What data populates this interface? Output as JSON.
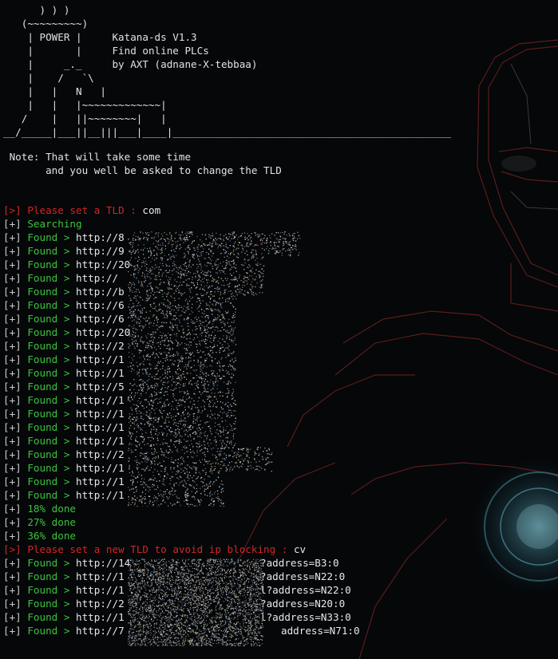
{
  "banner": {
    "art": "      ) ) )\n   (~~~~~~~~~)\n    | POWER |     Katana-ds V1.3\n    |       |     Find online PLCs\n    |     _._     by AXT (adnane-X-tebbaa)\n    |    /   `\\\n    |   |   N   |\n    |   |   |~~~~~~~~~~~~~|\n   /    |   ||~~~~~~~~|   |\n__/_____|___||__|||___|____|______________________________________________"
  },
  "note": {
    "line1": " Note: That will take some time",
    "line2": "       and you well be asked to change the TLD"
  },
  "log": [
    {
      "tag": "[>]",
      "label": "Please set a TLD : ",
      "value": "com",
      "kind": "prompt"
    },
    {
      "tag": "[+]",
      "label": "Searching",
      "value": "",
      "kind": "status"
    },
    {
      "tag": "[+]",
      "label": "Found > ",
      "value": "http://8",
      "kind": "found"
    },
    {
      "tag": "[+]",
      "label": "Found > ",
      "value": "http://9",
      "kind": "found"
    },
    {
      "tag": "[+]",
      "label": "Found > ",
      "value": "http://20",
      "kind": "found"
    },
    {
      "tag": "[+]",
      "label": "Found > ",
      "value": "http://",
      "kind": "found"
    },
    {
      "tag": "[+]",
      "label": "Found > ",
      "value": "http://b",
      "kind": "found"
    },
    {
      "tag": "[+]",
      "label": "Found > ",
      "value": "http://6",
      "kind": "found"
    },
    {
      "tag": "[+]",
      "label": "Found > ",
      "value": "http://6",
      "kind": "found"
    },
    {
      "tag": "[+]",
      "label": "Found > ",
      "value": "http://20",
      "kind": "found"
    },
    {
      "tag": "[+]",
      "label": "Found > ",
      "value": "http://2",
      "kind": "found"
    },
    {
      "tag": "[+]",
      "label": "Found > ",
      "value": "http://1",
      "kind": "found"
    },
    {
      "tag": "[+]",
      "label": "Found > ",
      "value": "http://1",
      "kind": "found"
    },
    {
      "tag": "[+]",
      "label": "Found > ",
      "value": "http://5",
      "kind": "found"
    },
    {
      "tag": "[+]",
      "label": "Found > ",
      "value": "http://1",
      "kind": "found"
    },
    {
      "tag": "[+]",
      "label": "Found > ",
      "value": "http://1",
      "kind": "found"
    },
    {
      "tag": "[+]",
      "label": "Found > ",
      "value": "http://1",
      "kind": "found"
    },
    {
      "tag": "[+]",
      "label": "Found > ",
      "value": "http://1",
      "kind": "found"
    },
    {
      "tag": "[+]",
      "label": "Found > ",
      "value": "http://2",
      "kind": "found"
    },
    {
      "tag": "[+]",
      "label": "Found > ",
      "value": "http://1",
      "kind": "found"
    },
    {
      "tag": "[+]",
      "label": "Found > ",
      "value": "http://1",
      "kind": "found"
    },
    {
      "tag": "[+]",
      "label": "Found > ",
      "value": "http://1",
      "kind": "found"
    },
    {
      "tag": "[+]",
      "label": "18% done",
      "value": "",
      "kind": "status"
    },
    {
      "tag": "[+]",
      "label": "27% done",
      "value": "",
      "kind": "status"
    },
    {
      "tag": "[+]",
      "label": "36% done",
      "value": "",
      "kind": "status"
    },
    {
      "tag": "[>]",
      "label": "Please set a new TLD to avoid ip blocking : ",
      "value": "cv",
      "kind": "prompt"
    },
    {
      "tag": "[+]",
      "label": "Found > ",
      "value": "http://14",
      "suffix": "?address=B3:0",
      "kind": "found"
    },
    {
      "tag": "[+]",
      "label": "Found > ",
      "value": "http://1",
      "suffix": "?address=N22:0",
      "kind": "found"
    },
    {
      "tag": "[+]",
      "label": "Found > ",
      "value": "http://1",
      "suffix": "l?address=N22:0",
      "kind": "found"
    },
    {
      "tag": "[+]",
      "label": "Found > ",
      "value": "http://2",
      "suffix": "?address=N20:0",
      "kind": "found"
    },
    {
      "tag": "[+]",
      "label": "Found > ",
      "value": "http://1",
      "suffix": "l?address=N33:0",
      "kind": "found"
    },
    {
      "tag": "[+]",
      "label": "Found > ",
      "value": "http://7",
      "suffix": "address=N71:0",
      "kind": "found"
    }
  ]
}
